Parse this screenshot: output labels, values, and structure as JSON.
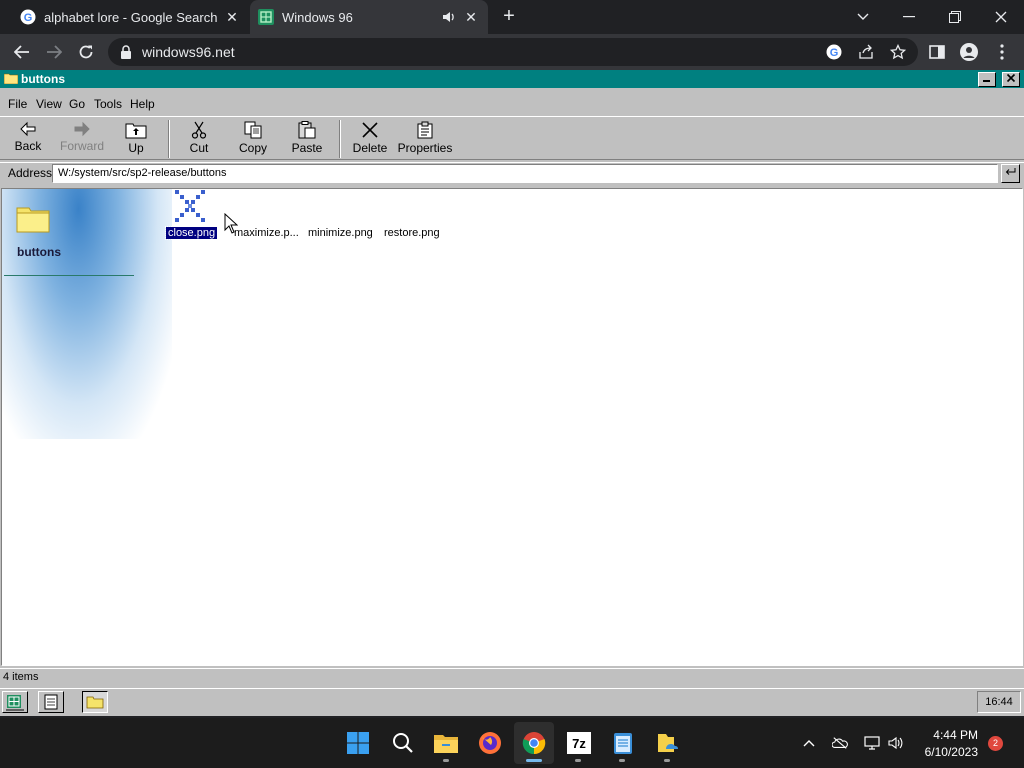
{
  "browser": {
    "tabs": [
      {
        "title": "alphabet lore - Google Search",
        "icon": "google-icon"
      },
      {
        "title": "Windows 96",
        "icon": "windows96-icon",
        "audio": true
      }
    ],
    "url": "windows96.net"
  },
  "window": {
    "title": "buttons",
    "menu": [
      "File",
      "View",
      "Go",
      "Tools",
      "Help"
    ],
    "toolbar": {
      "back": "Back",
      "forward": "Forward",
      "up": "Up",
      "cut": "Cut",
      "copy": "Copy",
      "paste": "Paste",
      "delete": "Delete",
      "properties": "Properties"
    },
    "address_label": "Address",
    "address_value": "W:/system/src/sp2-release/buttons",
    "folder_name": "buttons",
    "files": [
      {
        "name": "close.png",
        "selected": true
      },
      {
        "name": "maximize.p...",
        "selected": false
      },
      {
        "name": "minimize.png",
        "selected": false
      },
      {
        "name": "restore.png",
        "selected": false
      }
    ],
    "status": "4 items",
    "clock": "16:44"
  },
  "os_taskbar": {
    "time": "4:44 PM",
    "date": "6/10/2023",
    "notifications": "2",
    "accent": "#76b9ed"
  }
}
